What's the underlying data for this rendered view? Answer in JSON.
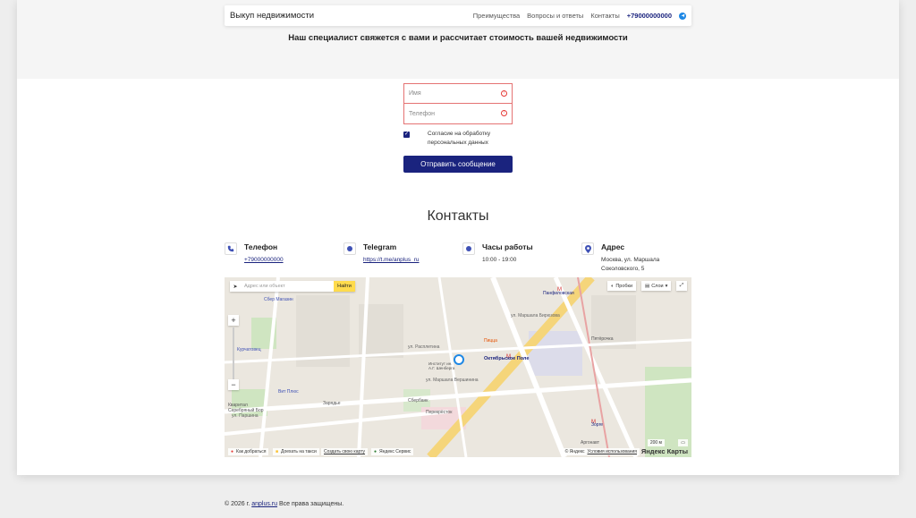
{
  "header": {
    "brand": "Выкуп недвижимости",
    "nav": [
      "Преимущества",
      "Вопросы и ответы",
      "Контакты"
    ],
    "phone": "+79000000000"
  },
  "hero": {
    "title": "Наш специалист свяжется с вами и рассчитает стоимость вашей недвижимости"
  },
  "form": {
    "name_placeholder": "Имя",
    "phone_placeholder": "Телефон",
    "consent_label": "Согласие на обработку персональных данных",
    "submit_label": "Отправить сообщение"
  },
  "contacts": {
    "title": "Контакты",
    "items": [
      {
        "title": "Телефон",
        "value": "+79000000000"
      },
      {
        "title": "Telegram",
        "value": "https://t.me/anplus_ru"
      },
      {
        "title": "Часы работы",
        "value": "10:00 - 19:00"
      },
      {
        "title": "Адрес",
        "value": "Москва, ул. Маршала Соколовского, 5"
      }
    ]
  },
  "map": {
    "search_placeholder": "Адрес или объект",
    "find_label": "Найти",
    "traffic_label": "Пробки",
    "layers_label": "Слои",
    "route_label": "Как добраться",
    "taxi_label": "Доехать на такси",
    "create_map_label": "Создать свою карту",
    "service_label": "Яндекс Сервис",
    "scale_label": "200 м",
    "copyright": "© Яндекс",
    "terms": "Условия использования",
    "logo": "Яндекс Карты",
    "labels": [
      "Октябрьское Поле",
      "Панфиловская",
      "Зорге",
      "ул. Маршала Бирюзова",
      "ул. Маршала Вершинина",
      "Пятёрочка",
      "Сбербанк",
      "Курчатовец",
      "Вит Плюс",
      "Зарядье",
      "Кваритал Серебряный Бор",
      "ул. Паршина",
      "ул. Расплетина",
      "Перекрёсток",
      "Пицца",
      "Аргонавт",
      "Сбер Магазин",
      "Институт ин. А.Г. Шенберга"
    ]
  },
  "footer": {
    "prefix": "© 2026 г.",
    "link": "anplus.ru",
    "suffix": "Все права защищены."
  }
}
